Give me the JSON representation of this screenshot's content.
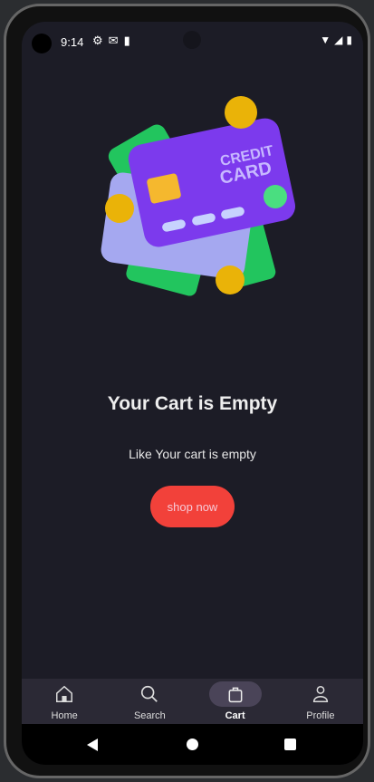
{
  "status": {
    "time": "9:14"
  },
  "main": {
    "title": "Your Cart is Empty",
    "subtitle": "Like Your cart is empty",
    "shop_button": "shop now",
    "card_text_1": "CREDIT",
    "card_text_2": "CARD"
  },
  "nav": {
    "items": [
      {
        "label": "Home"
      },
      {
        "label": "Search"
      },
      {
        "label": "Cart"
      },
      {
        "label": "Profile"
      }
    ],
    "active": "Cart"
  },
  "colors": {
    "background": "#1c1c26",
    "button": "#f2413a",
    "nav": "#2b2935",
    "card": "#7c3aed"
  }
}
